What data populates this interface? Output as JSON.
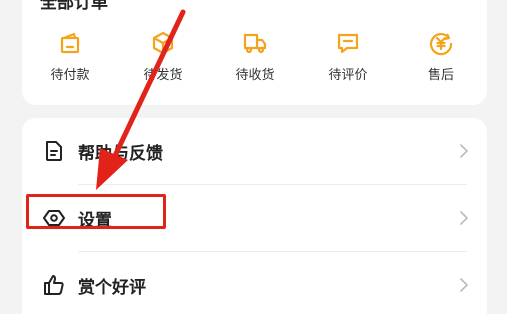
{
  "orders": {
    "title": "全部订单",
    "items": [
      {
        "label": "待付款",
        "icon": "wallet-icon"
      },
      {
        "label": "待发货",
        "icon": "box-icon"
      },
      {
        "label": "待收货",
        "icon": "truck-icon"
      },
      {
        "label": "待评价",
        "icon": "review-icon"
      },
      {
        "label": "售后",
        "icon": "yuan-refund-icon"
      }
    ]
  },
  "menu": {
    "items": [
      {
        "label": "帮助与反馈",
        "icon": "help-doc-icon"
      },
      {
        "label": "设置",
        "icon": "settings-icon"
      },
      {
        "label": "赏个好评",
        "icon": "thumbs-up-icon"
      }
    ]
  },
  "colors": {
    "accent": "#f5a31a",
    "annotation_red": "#e2231a",
    "background": "#f3f3f3",
    "card": "#ffffff"
  }
}
